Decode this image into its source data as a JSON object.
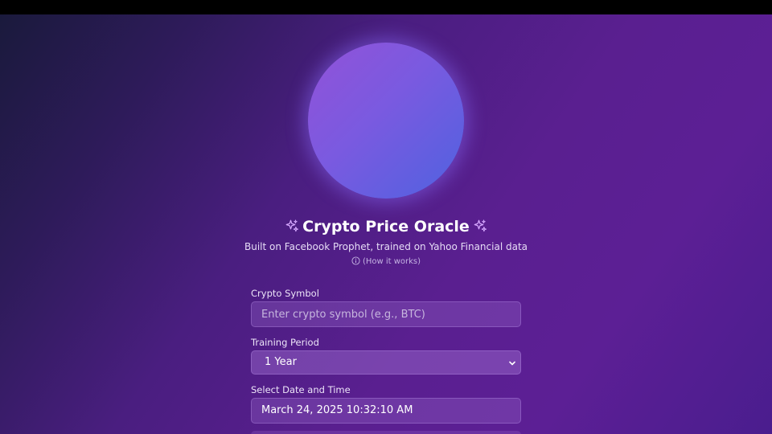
{
  "header": {
    "title": "Crypto Price Oracle",
    "subtitle": "Built on Facebook Prophet, trained on Yahoo Financial data",
    "how_it_works": "(How it works)"
  },
  "icons": {
    "left_sparkle": "sparkles-icon",
    "right_sparkle": "sparkles-icon",
    "info": "info-icon",
    "select_arrow": "chevron-down-icon"
  },
  "form": {
    "symbol": {
      "label": "Crypto Symbol",
      "placeholder": "Enter crypto symbol (e.g., BTC)",
      "value": ""
    },
    "training_period": {
      "label": "Training Period",
      "selected": "1 Year"
    },
    "datetime": {
      "label": "Select Date and Time",
      "value": "March 24, 2025 10:32:10 AM"
    }
  },
  "colors": {
    "orb_start": "#9252d8",
    "orb_end": "#4f62e0",
    "sparkle": "#d6a8ff",
    "background_dark": "#1a1a3c",
    "background_purple": "#5a1f90"
  }
}
